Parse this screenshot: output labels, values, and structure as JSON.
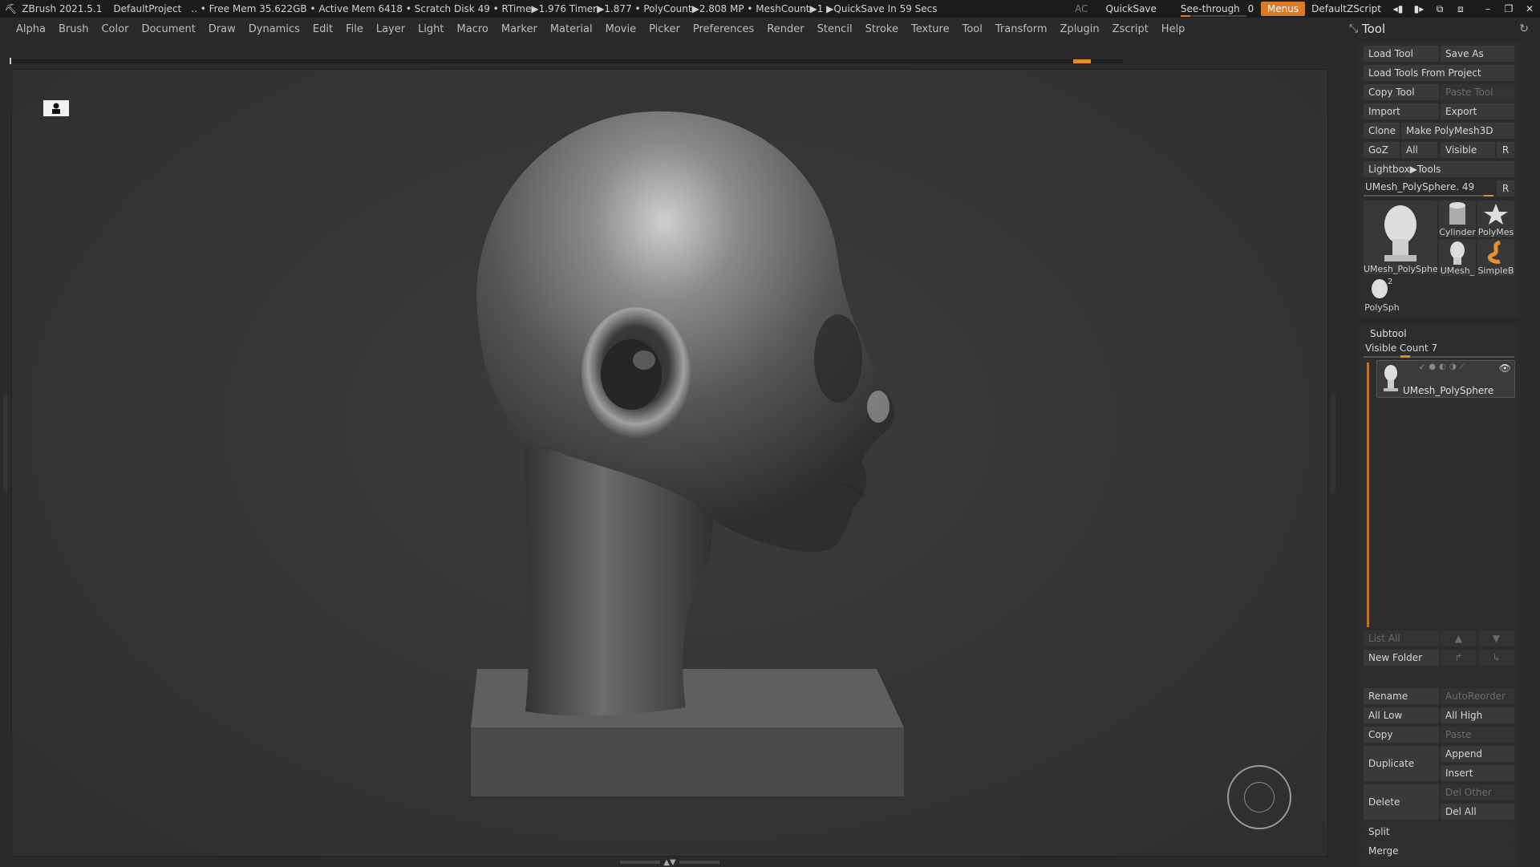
{
  "titlebar": {
    "app": "ZBrush 2021.5.1",
    "project": "DefaultProject",
    "stats": ".. • Free Mem 35.622GB • Active Mem 6418 • Scratch Disk 49 •  RTime▶1.976 Timer▶1.877 • PolyCount▶2.808 MP  • MeshCount▶1  ▶QuickSave In 59 Secs",
    "ac": "AC",
    "quicksave": "QuickSave",
    "see_through": "See-through",
    "see_through_value": "0",
    "see_through_level": 0.0,
    "menus": "Menus",
    "zscript": "DefaultZScript"
  },
  "menubar": [
    "Alpha",
    "Brush",
    "Color",
    "Document",
    "Draw",
    "Dynamics",
    "Edit",
    "File",
    "Layer",
    "Light",
    "Macro",
    "Marker",
    "Material",
    "Movie",
    "Picker",
    "Preferences",
    "Render",
    "Stencil",
    "Stroke",
    "Texture",
    "Tool",
    "Transform",
    "Zplugin",
    "Zscript",
    "Help"
  ],
  "tool_panel": {
    "title": "Tool",
    "load_tool": "Load Tool",
    "save_as": "Save As",
    "load_from_project": "Load Tools From Project",
    "copy_tool": "Copy Tool",
    "paste_tool": "Paste Tool",
    "import": "Import",
    "export": "Export",
    "clone": "Clone",
    "make_polymesh": "Make PolyMesh3D",
    "goz": "GoZ",
    "all": "All",
    "visible": "Visible",
    "r": "R",
    "lightbox": "Lightbox▶Tools",
    "current_tool": "UMesh_PolySphere. 49",
    "current_tool_r": "R",
    "current_tool_level": 0.92,
    "thumbnails": [
      "UMesh_PolySphe",
      "Cylinder",
      "PolyMes",
      "UMesh_",
      "SimpleB",
      "PolySph"
    ],
    "thumb_badge": "2"
  },
  "subtool": {
    "title": "Subtool",
    "visible_count": "Visible Count 7",
    "visible_count_level": 0.27,
    "item_name": "UMesh_PolySphere",
    "list_all": "List All",
    "new_folder": "New Folder",
    "rename": "Rename",
    "autoreorder": "AutoReorder",
    "all_low": "All Low",
    "all_high": "All High",
    "copy": "Copy",
    "paste": "Paste",
    "duplicate": "Duplicate",
    "append": "Append",
    "insert": "Insert",
    "delete": "Delete",
    "del_other": "Del Other",
    "del_all": "Del All",
    "split": "Split",
    "merge": "Merge"
  }
}
